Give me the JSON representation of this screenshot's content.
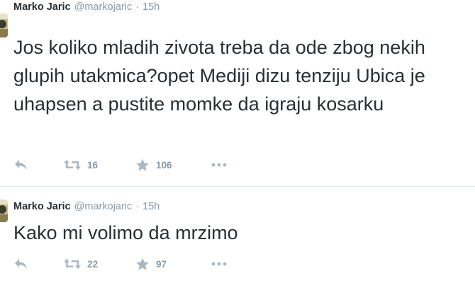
{
  "colors": {
    "text": "#292f33",
    "meta": "#8899a6",
    "icon": "#aab8c2",
    "divider": "#e1e8ed"
  },
  "icons": {
    "reply": "reply-icon",
    "retweet": "retweet-icon",
    "favorite": "star-icon",
    "more": "more-dots-icon"
  },
  "tweets": [
    {
      "name": "Marko Jaric",
      "handle": "@markojaric",
      "separator": "·",
      "time": "15h",
      "text": "Jos koliko mladih zivota treba da ode zbog nekih glupih utakmica?opet Mediji dizu tenziju Ubica je uhapsen a pustite momke da igraju kosarku",
      "retweets": "16",
      "favorites": "106"
    },
    {
      "name": "Marko Jaric",
      "handle": "@markojaric",
      "separator": "·",
      "time": "15h",
      "text": "Kako mi volimo da mrzimo",
      "retweets": "22",
      "favorites": "97"
    }
  ]
}
